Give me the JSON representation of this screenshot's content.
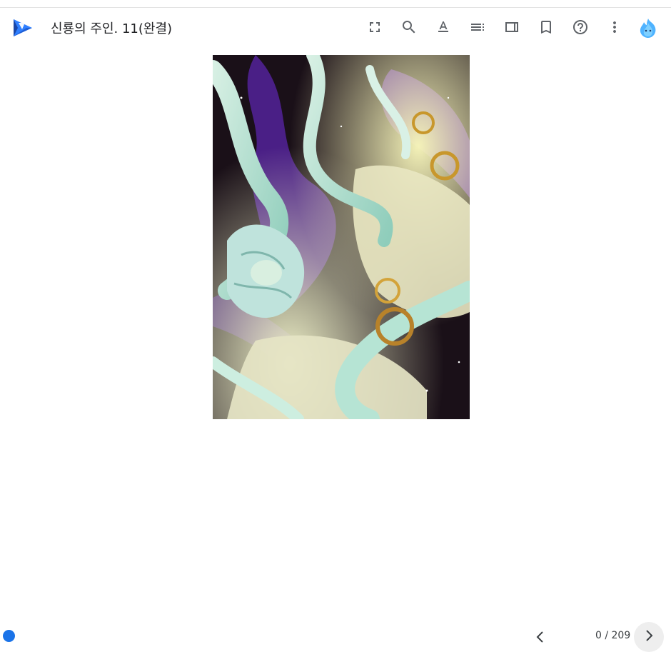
{
  "book": {
    "title": "신룡의 주인. 11(완결)"
  },
  "toolbar": {
    "buttons": [
      {
        "name": "fullscreen",
        "icon": "fullscreen-icon"
      },
      {
        "name": "search",
        "icon": "search-icon"
      },
      {
        "name": "text-format",
        "icon": "text-format-icon"
      },
      {
        "name": "table-of-contents",
        "icon": "toc-icon"
      },
      {
        "name": "page-view",
        "icon": "page-view-icon"
      },
      {
        "name": "bookmark",
        "icon": "bookmark-icon"
      },
      {
        "name": "help",
        "icon": "help-icon"
      },
      {
        "name": "more-options",
        "icon": "more-vert-icon"
      }
    ],
    "avatar": "blue-flame-avatar-icon"
  },
  "reader": {
    "page_indicator": "0 / 209"
  },
  "colors": {
    "accent": "#1a73e8",
    "icon": "#5f6368",
    "logo_dark": "#1a47a8",
    "logo_light": "#2f7fff"
  }
}
